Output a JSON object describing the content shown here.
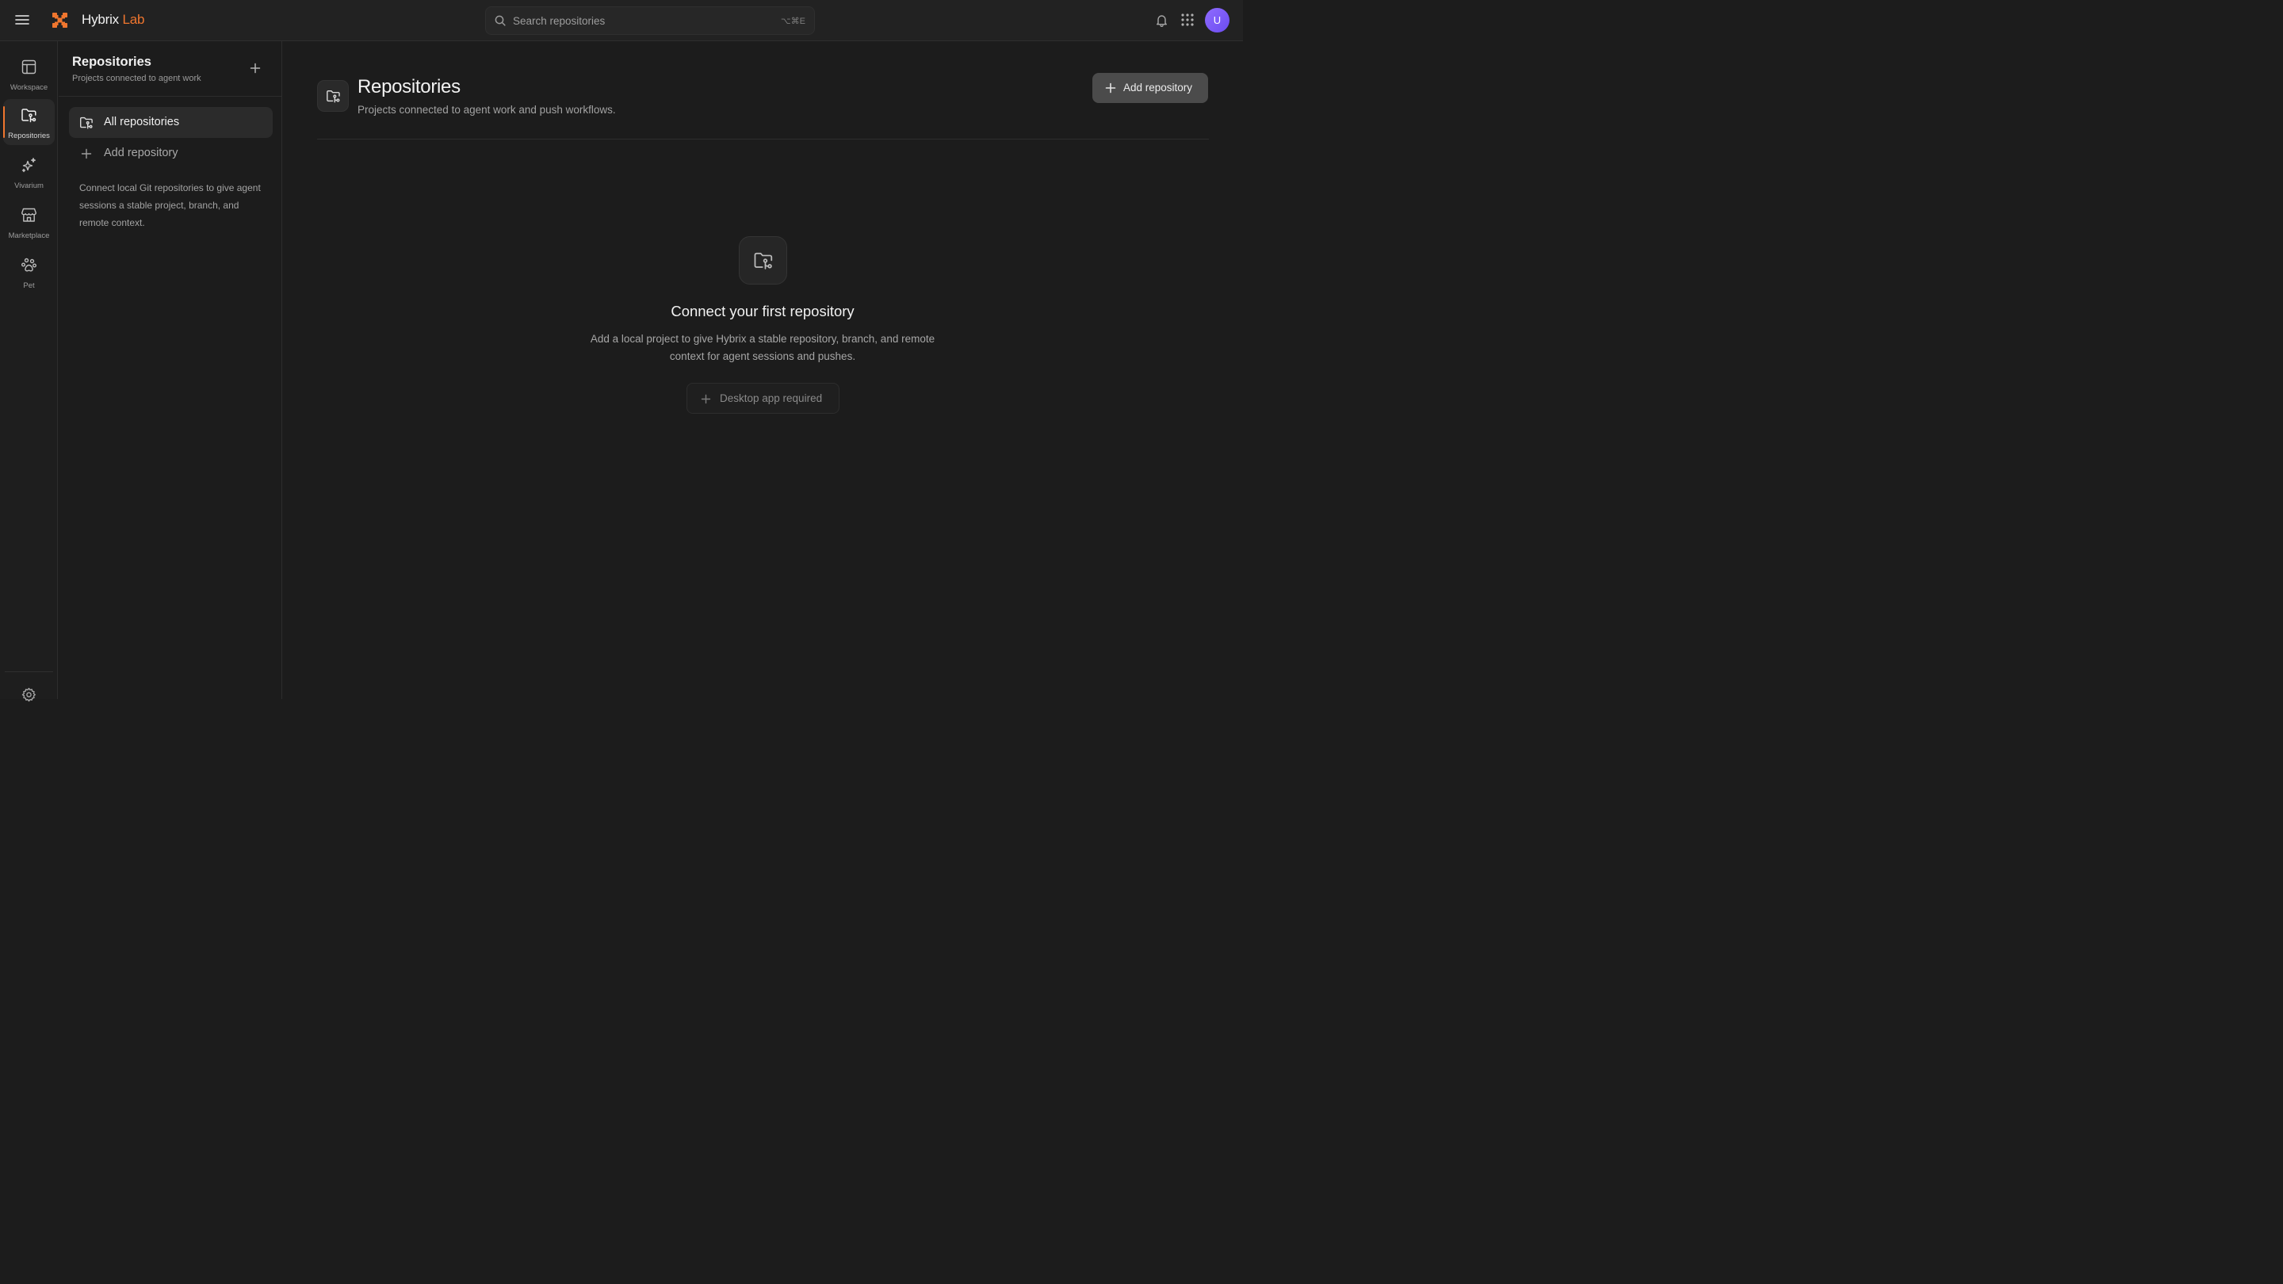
{
  "app": {
    "brand_primary": "Hybrix",
    "brand_accent": "Lab",
    "accent_color": "#f0762e"
  },
  "topbar": {
    "search_placeholder": "Search repositories",
    "search_shortcut": "⌥⌘E",
    "avatar_initial": "U",
    "icons": [
      "menu-icon",
      "hybrix-logo",
      "search-icon",
      "bell-icon",
      "apps-grid-icon"
    ]
  },
  "rail": {
    "items": [
      {
        "label": "Workspace",
        "icon": "workspace-icon",
        "active": false
      },
      {
        "label": "Repositories",
        "icon": "repository-folder-icon",
        "active": true
      },
      {
        "label": "Vivarium",
        "icon": "sparkles-icon",
        "active": false
      },
      {
        "label": "Marketplace",
        "icon": "storefront-icon",
        "active": false
      },
      {
        "label": "Pet",
        "icon": "paw-icon",
        "active": false
      }
    ],
    "footer_icon": "gear-icon"
  },
  "panel": {
    "title": "Repositories",
    "subtitle": "Projects connected to agent work",
    "nav": [
      {
        "label": "All repositories",
        "icon": "repository-folder-icon",
        "selected": true
      },
      {
        "label": "Add repository",
        "icon": "plus-icon",
        "selected": false
      }
    ],
    "help_text": "Connect local Git repositories to give agent sessions a stable project, branch, and remote context."
  },
  "main": {
    "title": "Repositories",
    "subtitle": "Projects connected to agent work and push workflows.",
    "add_button_label": "Add repository",
    "empty_state": {
      "title": "Connect your first repository",
      "description": "Add a local project to give Hybrix a stable repository, branch, and remote context for agent sessions and pushes.",
      "button_label": "Desktop app required",
      "button_disabled": true
    }
  }
}
